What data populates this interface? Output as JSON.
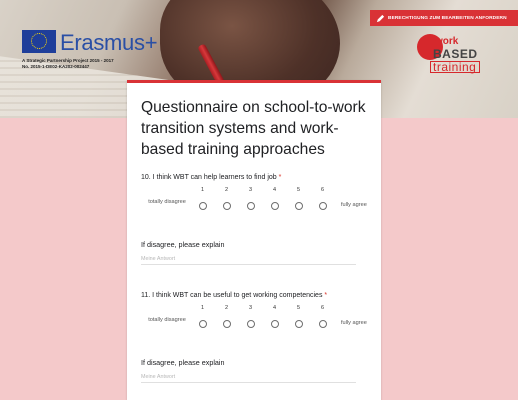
{
  "colors": {
    "accent": "#d93236",
    "page_background": "#f4c9ca",
    "card": "#ffffff"
  },
  "header": {
    "erasmus": {
      "logo_text": "Erasmus+",
      "subtitle": "A Strategic Partnership Project 2015 - 2017\nNo. 2015-1-DE02-KA202-002447"
    },
    "request_button": {
      "label": "BERECHTIGUNG ZUM BEARBEITEN ANFORDERN",
      "icon": "pencil-icon"
    },
    "wb_logo": {
      "line1": "work",
      "line2": "BASED",
      "line3": "training"
    }
  },
  "form": {
    "title": "Questionnaire on school-to-work transition systems and work-based training approaches",
    "questions": [
      {
        "label": "10. I think WBT can help learners to find job",
        "required_mark": "*",
        "scale": [
          "1",
          "2",
          "3",
          "4",
          "5",
          "6"
        ],
        "low_label": "totally disagree",
        "high_label": "fully agree",
        "followup_label": "If disagree, please explain",
        "followup_placeholder": "Meine Antwort"
      },
      {
        "label": "11. I think WBT can be useful to get working competencies",
        "required_mark": "*",
        "scale": [
          "1",
          "2",
          "3",
          "4",
          "5",
          "6"
        ],
        "low_label": "totally disagree",
        "high_label": "fully agree",
        "followup_label": "If disagree, please explain",
        "followup_placeholder": "Meine Antwort"
      }
    ]
  }
}
